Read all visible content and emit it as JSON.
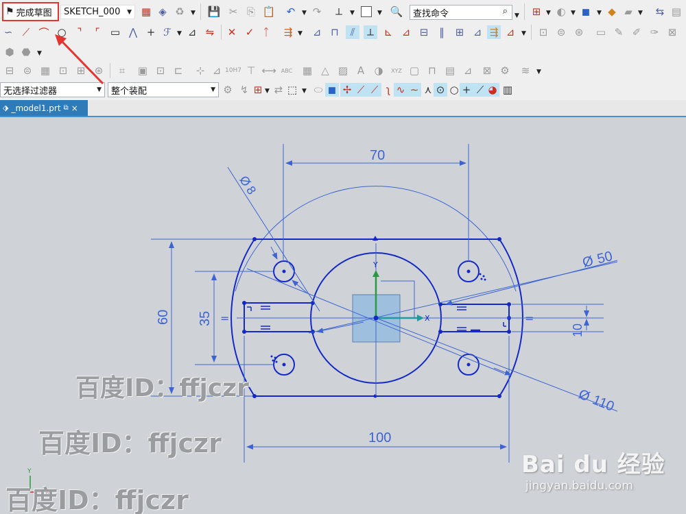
{
  "toolbar": {
    "finish_sketch_label": "完成草图",
    "sketch_name": "SKETCH_000",
    "command_search_placeholder": "查找命令",
    "selection_filter": "无选择过滤器",
    "assembly_scope": "整个装配"
  },
  "tab": {
    "file_name": "_model1.prt",
    "close_glyph": "×"
  },
  "sketch": {
    "dimensions": {
      "top_width": "70",
      "small_hole_dia": "8",
      "center_circle_dia": "50",
      "left_height": "60",
      "inner_height": "35",
      "slot_height": "10",
      "outer_arc_dia": "110",
      "bottom_width": "100"
    },
    "symbols": {
      "diameter": "Ø",
      "equal": "="
    },
    "axes": {
      "x": "X",
      "y": "Y"
    }
  },
  "watermark": {
    "text1": "百度ID：ffjczr",
    "text2": "百度ID：ffjczr",
    "text3": "百度ID：ffjczr",
    "baidu_logo": "Bai du 经验",
    "baidu_url": "jingyan.baidu.com"
  },
  "colors": {
    "sketch_line": "#1428c8",
    "dimension": "#3d64d2",
    "highlight_red": "#e53530",
    "tab_blue": "#2f7bb8",
    "canvas_bg": "#cfd3d8"
  }
}
